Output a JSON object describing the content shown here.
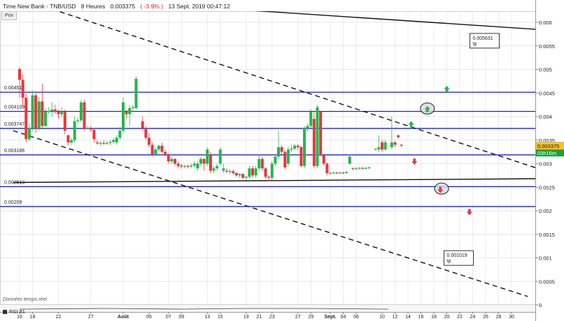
{
  "header": {
    "title": "Time New Bank - TNB/USD",
    "timeframe": "8 Heures",
    "price": "0.003375",
    "change": "( -3.9% )",
    "datetime": "13 Sept. 2019 00:47:12"
  },
  "toolbar": {
    "prix_label": "Prix"
  },
  "footer": {
    "note": "Données temps réel",
    "indicator_label": "RSI 81"
  },
  "price_label": {
    "value": "0.003375",
    "timer": "03h16m",
    "color": "#f2c230",
    "timer_color": "#1aa33a"
  },
  "colors": {
    "up": "#22b84a",
    "down": "#e8373d",
    "support": "#1c22c8",
    "trend": "#111111"
  },
  "chart_data": {
    "type": "candlestick",
    "y_axis": {
      "range": [
        0,
        0.0062
      ],
      "ticks": [
        {
          "v": 0,
          "label": "0"
        },
        {
          "v": 0.0005,
          "label": "0.0005"
        },
        {
          "v": 0.001,
          "label": "0.001"
        },
        {
          "v": 0.0015,
          "label": "0.0015"
        },
        {
          "v": 0.002,
          "label": "0.002"
        },
        {
          "v": 0.0025,
          "label": "0.0025"
        },
        {
          "v": 0.003,
          "label": "0.003"
        },
        {
          "v": 0.0035,
          "label": "0.0035"
        },
        {
          "v": 0.004,
          "label": "0.004"
        },
        {
          "v": 0.0045,
          "label": "0.0045"
        },
        {
          "v": 0.005,
          "label": "0.005"
        },
        {
          "v": 0.0055,
          "label": "0.0055"
        },
        {
          "v": 0.006,
          "label": "0.006"
        }
      ]
    },
    "x_axis": {
      "ticks": [
        {
          "d": 0,
          "label": "16"
        },
        {
          "d": 2,
          "label": "18"
        },
        {
          "d": 6,
          "label": "22"
        },
        {
          "d": 11,
          "label": "27"
        },
        {
          "d": 16,
          "label": "Août"
        },
        {
          "d": 20,
          "label": "05"
        },
        {
          "d": 23,
          "label": "07"
        },
        {
          "d": 25,
          "label": "09"
        },
        {
          "d": 29,
          "label": "13"
        },
        {
          "d": 31,
          "label": "15"
        },
        {
          "d": 35,
          "label": "19"
        },
        {
          "d": 37,
          "label": "21"
        },
        {
          "d": 39,
          "label": "23"
        },
        {
          "d": 43,
          "label": "27"
        },
        {
          "d": 45,
          "label": "29"
        },
        {
          "d": 48,
          "label": "Sept."
        },
        {
          "d": 50,
          "label": "04"
        },
        {
          "d": 52,
          "label": "06"
        },
        {
          "d": 56,
          "label": "10"
        },
        {
          "d": 58,
          "label": "12"
        },
        {
          "d": 60,
          "label": "14"
        },
        {
          "d": 62,
          "label": "16"
        },
        {
          "d": 64,
          "label": "18"
        },
        {
          "d": 66,
          "label": "20"
        },
        {
          "d": 68,
          "label": "22"
        },
        {
          "d": 70,
          "label": "24"
        },
        {
          "d": 72,
          "label": "26"
        },
        {
          "d": 74,
          "label": "28"
        },
        {
          "d": 76,
          "label": "30"
        }
      ]
    },
    "candles": [
      {
        "d": 0.0,
        "o": 0.00501,
        "c": 0.00478,
        "h": 0.00505,
        "l": 0.0044
      },
      {
        "d": 0.5,
        "o": 0.00478,
        "c": 0.0044,
        "h": 0.0049,
        "l": 0.0042
      },
      {
        "d": 1.0,
        "o": 0.0044,
        "c": 0.00352,
        "h": 0.00448,
        "l": 0.00345
      },
      {
        "d": 1.5,
        "o": 0.00352,
        "c": 0.00375,
        "h": 0.00385,
        "l": 0.00348
      },
      {
        "d": 2.0,
        "o": 0.00375,
        "c": 0.00445,
        "h": 0.00455,
        "l": 0.0037
      },
      {
        "d": 2.5,
        "o": 0.00445,
        "c": 0.00375,
        "h": 0.0045,
        "l": 0.00365
      },
      {
        "d": 3.0,
        "o": 0.00375,
        "c": 0.00432,
        "h": 0.00442,
        "l": 0.0037
      },
      {
        "d": 3.5,
        "o": 0.00432,
        "c": 0.0038,
        "h": 0.0047,
        "l": 0.00375
      },
      {
        "d": 4.0,
        "o": 0.0038,
        "c": 0.0041,
        "h": 0.00418,
        "l": 0.00378
      },
      {
        "d": 4.5,
        "o": 0.0041,
        "c": 0.00412,
        "h": 0.0042,
        "l": 0.00405
      },
      {
        "d": 5.0,
        "o": 0.00412,
        "c": 0.00415,
        "h": 0.0043,
        "l": 0.004
      },
      {
        "d": 5.5,
        "o": 0.00415,
        "c": 0.0041,
        "h": 0.00425,
        "l": 0.00405
      },
      {
        "d": 6.0,
        "o": 0.0041,
        "c": 0.00405,
        "h": 0.00415,
        "l": 0.00395
      },
      {
        "d": 6.5,
        "o": 0.00405,
        "c": 0.0041,
        "h": 0.0042,
        "l": 0.00398
      },
      {
        "d": 7.0,
        "o": 0.0041,
        "c": 0.0037,
        "h": 0.00415,
        "l": 0.00362
      },
      {
        "d": 7.5,
        "o": 0.0036,
        "c": 0.00345,
        "h": 0.00362,
        "l": 0.00338
      },
      {
        "d": 8.0,
        "o": 0.00345,
        "c": 0.0035,
        "h": 0.00355,
        "l": 0.0034
      },
      {
        "d": 8.5,
        "o": 0.0035,
        "c": 0.0039,
        "h": 0.004,
        "l": 0.00345
      },
      {
        "d": 9.0,
        "o": 0.0039,
        "c": 0.00392,
        "h": 0.00398,
        "l": 0.00385
      },
      {
        "d": 9.5,
        "o": 0.00392,
        "c": 0.0043,
        "h": 0.00435,
        "l": 0.00388
      },
      {
        "d": 10.0,
        "o": 0.0043,
        "c": 0.00375,
        "h": 0.00435,
        "l": 0.0037
      },
      {
        "d": 10.5,
        "o": 0.00375,
        "c": 0.00376,
        "h": 0.0038,
        "l": 0.00372
      },
      {
        "d": 11.0,
        "o": 0.00376,
        "c": 0.00372,
        "h": 0.0038,
        "l": 0.00368
      },
      {
        "d": 11.5,
        "o": 0.00372,
        "c": 0.00352,
        "h": 0.00375,
        "l": 0.00345
      },
      {
        "d": 12.0,
        "o": 0.00345,
        "c": 0.00343,
        "h": 0.0035,
        "l": 0.0034
      },
      {
        "d": 12.5,
        "o": 0.00343,
        "c": 0.00344,
        "h": 0.00348,
        "l": 0.00338
      },
      {
        "d": 13.0,
        "o": 0.00344,
        "c": 0.00343,
        "h": 0.0035,
        "l": 0.0034
      },
      {
        "d": 13.5,
        "o": 0.00343,
        "c": 0.00344,
        "h": 0.00348,
        "l": 0.0034
      },
      {
        "d": 14.0,
        "o": 0.00344,
        "c": 0.00346,
        "h": 0.0035,
        "l": 0.0034
      },
      {
        "d": 14.5,
        "o": 0.00346,
        "c": 0.0035,
        "h": 0.00355,
        "l": 0.00342
      },
      {
        "d": 15.0,
        "o": 0.00345,
        "c": 0.00355,
        "h": 0.0036,
        "l": 0.0034
      },
      {
        "d": 15.5,
        "o": 0.00355,
        "c": 0.0037,
        "h": 0.00378,
        "l": 0.0035
      },
      {
        "d": 16.0,
        "o": 0.0037,
        "c": 0.0043,
        "h": 0.0044,
        "l": 0.00365
      },
      {
        "d": 16.5,
        "o": 0.0041,
        "c": 0.00405,
        "h": 0.00415,
        "l": 0.00395
      },
      {
        "d": 17.0,
        "o": 0.00405,
        "c": 0.00418,
        "h": 0.00425,
        "l": 0.0038
      },
      {
        "d": 17.5,
        "o": 0.00418,
        "c": 0.0042,
        "h": 0.00425,
        "l": 0.0041
      },
      {
        "d": 18.0,
        "o": 0.00418,
        "c": 0.0048,
        "h": 0.00485,
        "l": 0.00415
      },
      {
        "d": 19.0,
        "o": 0.0039,
        "c": 0.00375,
        "h": 0.004,
        "l": 0.0037
      },
      {
        "d": 19.5,
        "o": 0.00375,
        "c": 0.00355,
        "h": 0.0038,
        "l": 0.0035
      },
      {
        "d": 20.0,
        "o": 0.00355,
        "c": 0.0034,
        "h": 0.00365,
        "l": 0.00335
      },
      {
        "d": 20.5,
        "o": 0.0034,
        "c": 0.0032,
        "h": 0.00345,
        "l": 0.00315
      },
      {
        "d": 21.0,
        "o": 0.0032,
        "c": 0.0033,
        "h": 0.00335,
        "l": 0.00318
      },
      {
        "d": 21.5,
        "o": 0.0033,
        "c": 0.00338,
        "h": 0.0034,
        "l": 0.00325
      },
      {
        "d": 22.0,
        "o": 0.00338,
        "c": 0.00325,
        "h": 0.00345,
        "l": 0.00322
      },
      {
        "d": 22.5,
        "o": 0.00325,
        "c": 0.0032,
        "h": 0.0033,
        "l": 0.00315
      },
      {
        "d": 23.0,
        "o": 0.0032,
        "c": 0.00305,
        "h": 0.00322,
        "l": 0.003
      },
      {
        "d": 23.5,
        "o": 0.00305,
        "c": 0.0031,
        "h": 0.00315,
        "l": 0.003
      },
      {
        "d": 24.0,
        "o": 0.0031,
        "c": 0.003,
        "h": 0.00312,
        "l": 0.00296
      },
      {
        "d": 24.5,
        "o": 0.003,
        "c": 0.00295,
        "h": 0.00305,
        "l": 0.0029
      },
      {
        "d": 25.0,
        "o": 0.00296,
        "c": 0.00294,
        "h": 0.003,
        "l": 0.0029
      },
      {
        "d": 25.5,
        "o": 0.00294,
        "c": 0.00295,
        "h": 0.00298,
        "l": 0.0029
      },
      {
        "d": 26.0,
        "o": 0.00295,
        "c": 0.00294,
        "h": 0.00298,
        "l": 0.0029
      },
      {
        "d": 26.5,
        "o": 0.00294,
        "c": 0.00296,
        "h": 0.003,
        "l": 0.0029
      },
      {
        "d": 27.0,
        "o": 0.00296,
        "c": 0.003,
        "h": 0.00305,
        "l": 0.00292
      },
      {
        "d": 27.5,
        "o": 0.0029,
        "c": 0.003,
        "h": 0.00305,
        "l": 0.00285
      },
      {
        "d": 28.0,
        "o": 0.003,
        "c": 0.0031,
        "h": 0.00315,
        "l": 0.00295
      },
      {
        "d": 28.5,
        "o": 0.0031,
        "c": 0.003,
        "h": 0.00312,
        "l": 0.00285
      },
      {
        "d": 29.0,
        "o": 0.003,
        "c": 0.0033,
        "h": 0.00335,
        "l": 0.00295
      },
      {
        "d": 29.5,
        "o": 0.0032,
        "c": 0.00285,
        "h": 0.00325,
        "l": 0.0028
      },
      {
        "d": 30.0,
        "o": 0.00285,
        "c": 0.0029,
        "h": 0.00295,
        "l": 0.0028
      },
      {
        "d": 30.5,
        "o": 0.0029,
        "c": 0.00295,
        "h": 0.003,
        "l": 0.00285
      },
      {
        "d": 31.0,
        "o": 0.003,
        "c": 0.0033,
        "h": 0.00335,
        "l": 0.00295
      },
      {
        "d": 31.5,
        "o": 0.00285,
        "c": 0.0029,
        "h": 0.003,
        "l": 0.0028
      },
      {
        "d": 32.0,
        "o": 0.00285,
        "c": 0.00283,
        "h": 0.0029,
        "l": 0.0028
      },
      {
        "d": 32.5,
        "o": 0.00283,
        "c": 0.00284,
        "h": 0.00288,
        "l": 0.00278
      },
      {
        "d": 33.0,
        "o": 0.00284,
        "c": 0.0028,
        "h": 0.00288,
        "l": 0.00276
      },
      {
        "d": 33.5,
        "o": 0.0028,
        "c": 0.00275,
        "h": 0.00282,
        "l": 0.00272
      },
      {
        "d": 34.0,
        "o": 0.00275,
        "c": 0.00278,
        "h": 0.0028,
        "l": 0.0027
      },
      {
        "d": 34.5,
        "o": 0.00278,
        "c": 0.0027,
        "h": 0.0028,
        "l": 0.00268
      },
      {
        "d": 35.0,
        "o": 0.0027,
        "c": 0.00272,
        "h": 0.00275,
        "l": 0.00266
      },
      {
        "d": 35.5,
        "o": 0.00272,
        "c": 0.0029,
        "h": 0.00295,
        "l": 0.00268
      },
      {
        "d": 36.0,
        "o": 0.0029,
        "c": 0.00275,
        "h": 0.00295,
        "l": 0.0027
      },
      {
        "d": 36.5,
        "o": 0.00275,
        "c": 0.0029,
        "h": 0.00295,
        "l": 0.0027
      },
      {
        "d": 37.0,
        "o": 0.0029,
        "c": 0.0031,
        "h": 0.0032,
        "l": 0.00285
      },
      {
        "d": 37.5,
        "o": 0.0031,
        "c": 0.0029,
        "h": 0.00315,
        "l": 0.00285
      },
      {
        "d": 38.0,
        "o": 0.0029,
        "c": 0.00272,
        "h": 0.00292,
        "l": 0.00268
      },
      {
        "d": 38.5,
        "o": 0.00272,
        "c": 0.0027,
        "h": 0.00275,
        "l": 0.00265
      },
      {
        "d": 39.0,
        "o": 0.0027,
        "c": 0.003,
        "h": 0.00305,
        "l": 0.00265
      },
      {
        "d": 39.5,
        "o": 0.003,
        "c": 0.00315,
        "h": 0.0032,
        "l": 0.00295
      },
      {
        "d": 40.0,
        "o": 0.00315,
        "c": 0.00335,
        "h": 0.0037,
        "l": 0.0031
      },
      {
        "d": 40.5,
        "o": 0.00335,
        "c": 0.00325,
        "h": 0.0034,
        "l": 0.0032
      },
      {
        "d": 41.0,
        "o": 0.00325,
        "c": 0.00292,
        "h": 0.00328,
        "l": 0.00288
      },
      {
        "d": 41.5,
        "o": 0.003,
        "c": 0.0033,
        "h": 0.00336,
        "l": 0.00295
      },
      {
        "d": 42.0,
        "o": 0.0033,
        "c": 0.00332,
        "h": 0.0034,
        "l": 0.00325
      },
      {
        "d": 42.5,
        "o": 0.00332,
        "c": 0.00338,
        "h": 0.00342,
        "l": 0.00328
      },
      {
        "d": 43.0,
        "o": 0.00338,
        "c": 0.00335,
        "h": 0.00342,
        "l": 0.0033
      },
      {
        "d": 43.5,
        "o": 0.00335,
        "c": 0.00295,
        "h": 0.00338,
        "l": 0.00292
      },
      {
        "d": 44.0,
        "o": 0.00295,
        "c": 0.00375,
        "h": 0.0038,
        "l": 0.0029
      },
      {
        "d": 44.5,
        "o": 0.00375,
        "c": 0.0038,
        "h": 0.00385,
        "l": 0.00368
      },
      {
        "d": 45.0,
        "o": 0.0038,
        "c": 0.0041,
        "h": 0.00415,
        "l": 0.00375
      },
      {
        "d": 45.5,
        "o": 0.00395,
        "c": 0.00295,
        "h": 0.0041,
        "l": 0.0029
      },
      {
        "d": 46.0,
        "o": 0.00295,
        "c": 0.0042,
        "h": 0.00425,
        "l": 0.0029
      },
      {
        "d": 46.5,
        "o": 0.0041,
        "c": 0.00318,
        "h": 0.00412,
        "l": 0.00315
      },
      {
        "d": 47.0,
        "o": 0.00318,
        "c": 0.003,
        "h": 0.0032,
        "l": 0.00295
      },
      {
        "d": 47.5,
        "o": 0.003,
        "c": 0.0028,
        "h": 0.00302,
        "l": 0.00275
      },
      {
        "d": 48.0,
        "o": 0.0028,
        "c": 0.0028,
        "h": 0.00282,
        "l": 0.00278
      },
      {
        "d": 48.5,
        "o": 0.0028,
        "c": 0.00281,
        "h": 0.00283,
        "l": 0.00278
      },
      {
        "d": 49.0,
        "o": 0.00281,
        "c": 0.0028,
        "h": 0.00283,
        "l": 0.00278
      },
      {
        "d": 49.5,
        "o": 0.0028,
        "c": 0.00281,
        "h": 0.00283,
        "l": 0.00278
      },
      {
        "d": 50.0,
        "o": 0.00281,
        "c": 0.0028,
        "h": 0.00283,
        "l": 0.00278
      },
      {
        "d": 50.5,
        "o": 0.0028,
        "c": 0.00282,
        "h": 0.00285,
        "l": 0.00278
      },
      {
        "d": 51.0,
        "o": 0.003,
        "c": 0.00315,
        "h": 0.0032,
        "l": 0.00298
      },
      {
        "d": 51.5,
        "o": 0.0029,
        "c": 0.00289,
        "h": 0.00292,
        "l": 0.00287
      },
      {
        "d": 52.0,
        "o": 0.00289,
        "c": 0.0029,
        "h": 0.00293,
        "l": 0.00287
      },
      {
        "d": 52.5,
        "o": 0.0029,
        "c": 0.00291,
        "h": 0.00293,
        "l": 0.00288
      },
      {
        "d": 53.0,
        "o": 0.00291,
        "c": 0.0029,
        "h": 0.00293,
        "l": 0.00288
      },
      {
        "d": 53.5,
        "o": 0.0029,
        "c": 0.00291,
        "h": 0.00293,
        "l": 0.00288
      },
      {
        "d": 54.0,
        "o": 0.00291,
        "c": 0.00292,
        "h": 0.00294,
        "l": 0.00289
      },
      {
        "d": 55.0,
        "o": 0.0033,
        "c": 0.00331,
        "h": 0.00333,
        "l": 0.00328
      },
      {
        "d": 55.5,
        "o": 0.0033,
        "c": 0.00335,
        "h": 0.0036,
        "l": 0.00325
      },
      {
        "d": 56.0,
        "o": 0.00345,
        "c": 0.0033,
        "h": 0.0035,
        "l": 0.00325
      },
      {
        "d": 56.5,
        "o": 0.0033,
        "c": 0.00345,
        "h": 0.0035,
        "l": 0.00328
      },
      {
        "d": 57.5,
        "o": 0.00335,
        "c": 0.00345,
        "h": 0.004,
        "l": 0.0033
      },
      {
        "d": 58.0,
        "o": 0.00345,
        "c": 0.0034,
        "h": 0.00348,
        "l": 0.00335
      },
      {
        "d": 58.5,
        "o": 0.0036,
        "c": 0.00356,
        "h": 0.00362,
        "l": 0.00354
      },
      {
        "d": 59.0,
        "o": 0.0034,
        "c": 0.00338,
        "h": 0.00342,
        "l": 0.00335
      }
    ],
    "levels": [
      {
        "v": 0.004517,
        "label": "0.004517"
      },
      {
        "v": 0.004109,
        "label": "0.004109"
      },
      {
        "v": 0.003747,
        "label": "0.003747"
      },
      {
        "v": 0.003186,
        "label": "0.003186"
      },
      {
        "v": 0.002513,
        "label": "0.002513"
      },
      {
        "v": 0.00209,
        "label": "0.00209"
      }
    ],
    "trendlines": [
      {
        "style": "solid",
        "from": {
          "d": 36.0,
          "v": 0.00625
        },
        "to": {
          "d": 80.0,
          "v": 0.00585
        }
      },
      {
        "style": "dashed",
        "from": {
          "d": 5.0,
          "v": 0.00628
        },
        "to": {
          "d": 80.0,
          "v": 0.0029
        }
      },
      {
        "style": "dashed",
        "from": {
          "d": -1.0,
          "v": 0.0037
        },
        "to": {
          "d": 78.5,
          "v": 0.00018
        }
      },
      {
        "style": "solid",
        "from": {
          "d": -1.0,
          "v": 0.0026
        },
        "to": {
          "d": 80.0,
          "v": 0.00268
        }
      }
    ],
    "targets": [
      {
        "label": "0.005631",
        "sub": "tp",
        "d": 70.0,
        "v": 0.005631
      },
      {
        "label": "0.001019",
        "sub": "tp",
        "d": 66.0,
        "v": 0.001019
      }
    ],
    "arrows": [
      {
        "dir": "up",
        "d": 60.5,
        "v": 0.00383
      },
      {
        "dir": "up",
        "d": 63.0,
        "v": 0.00415
      },
      {
        "dir": "up",
        "d": 66.0,
        "v": 0.00458
      },
      {
        "dir": "down",
        "d": 61.0,
        "v": 0.00305
      },
      {
        "dir": "down",
        "d": 65.0,
        "v": 0.00245
      },
      {
        "dir": "down",
        "d": 69.5,
        "v": 0.00198
      }
    ],
    "circles": [
      {
        "d": 63.0,
        "v": 0.00417
      },
      {
        "d": 65.2,
        "v": 0.00247
      }
    ]
  }
}
